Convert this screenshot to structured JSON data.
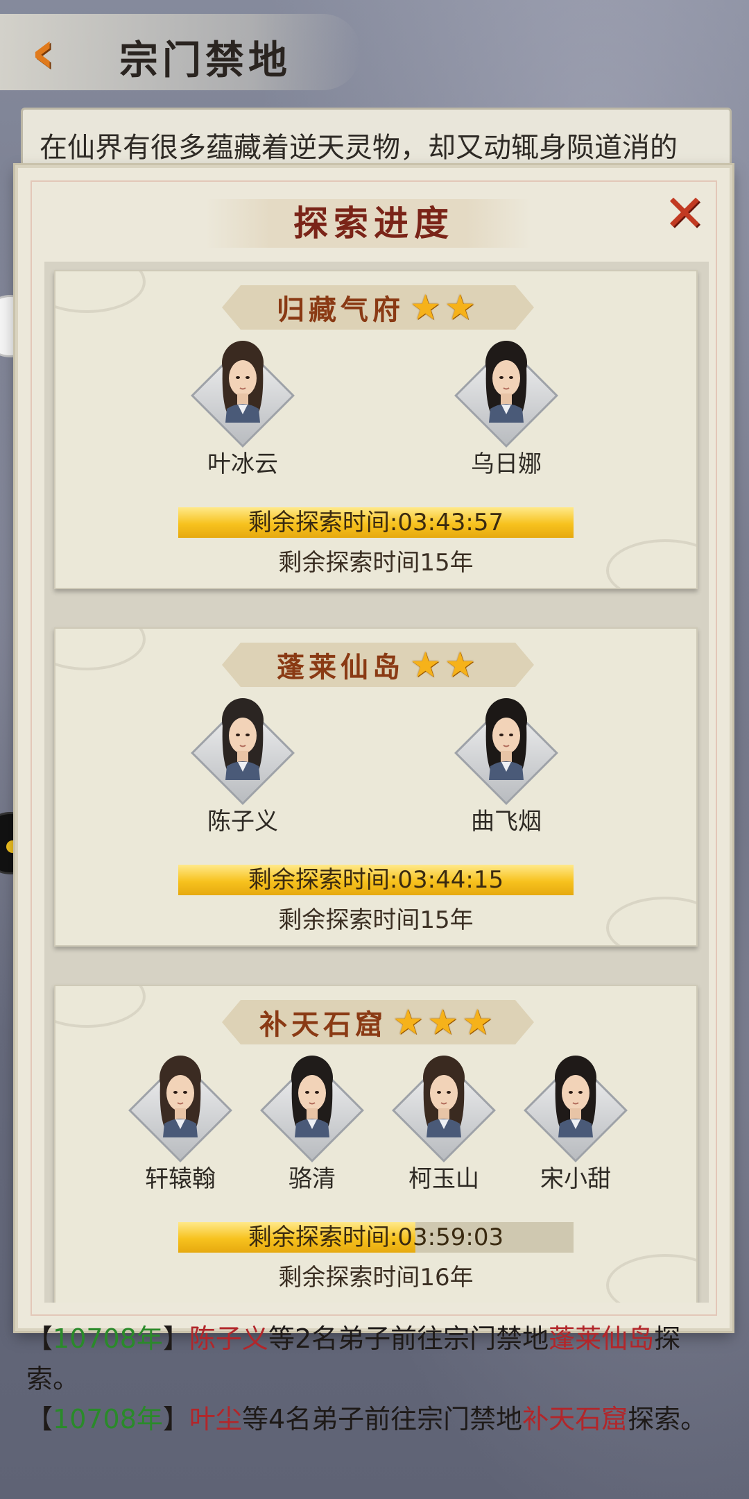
{
  "header": {
    "back_label": "‹",
    "title": "宗门禁地"
  },
  "intro_text": "在仙界有很多蕴藏着逆天灵物，却又动辄身陨道消的",
  "dialog": {
    "title": "探索进度",
    "close_label": "✕",
    "cards": [
      {
        "name": "归藏气府",
        "stars": 2,
        "members": [
          "叶冰云",
          "乌日娜"
        ],
        "timer": "剩余探索时间:03:43:57",
        "progress": 1.0,
        "years": "剩余探索时间15年"
      },
      {
        "name": "蓬莱仙岛",
        "stars": 2,
        "members": [
          "陈子义",
          "曲飞烟"
        ],
        "timer": "剩余探索时间:03:44:15",
        "progress": 1.0,
        "years": "剩余探索时间15年"
      },
      {
        "name": "补天石窟",
        "stars": 3,
        "members": [
          "轩辕翰",
          "骆清",
          "柯玉山",
          "宋小甜"
        ],
        "timer": "剩余探索时间:03:59:03",
        "progress": 0.6,
        "years": "剩余探索时间16年"
      }
    ]
  },
  "log": [
    {
      "open": "【",
      "year": "10708年",
      "close": "】",
      "name": "陈子义",
      "mid": "等2名弟子前往宗门禁地",
      "place": "蓬莱仙岛",
      "end": "探索。"
    },
    {
      "open": "【",
      "year": "10708年",
      "close": "】",
      "name": "叶尘",
      "mid": "等4名弟子前往宗门禁地",
      "place": "补天石窟",
      "end": "探索。"
    }
  ],
  "icons": {
    "back": "back-arrow-icon",
    "close": "close-icon",
    "star": "star-icon"
  },
  "colors": {
    "accent_orange": "#e07a1c",
    "title_red": "#7a2418",
    "star_gold": "#f6b21a",
    "log_year_green": "#2a8a2a",
    "log_name_red": "#b2262a"
  }
}
